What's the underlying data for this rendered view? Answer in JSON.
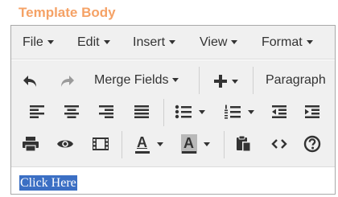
{
  "section": {
    "title": "Template Body"
  },
  "menubar": {
    "items": [
      {
        "label": "File"
      },
      {
        "label": "Edit"
      },
      {
        "label": "Insert"
      },
      {
        "label": "View"
      },
      {
        "label": "Format"
      }
    ]
  },
  "toolbar": {
    "row1": {
      "undo_icon": "undo-icon",
      "redo_icon": "redo-icon",
      "merge_fields_label": "Merge Fields",
      "insert_icon": "plus-icon",
      "block_format_label": "Paragraph"
    },
    "row2": {
      "icons": [
        "align-left-icon",
        "align-center-icon",
        "align-right-icon",
        "align-justify-icon",
        "bullet-list-icon",
        "numbered-list-icon",
        "outdent-icon",
        "indent-icon"
      ]
    },
    "row3": {
      "icons": [
        "print-icon",
        "preview-eye-icon",
        "media-icon",
        "text-color-icon",
        "background-color-icon",
        "paste-icon",
        "code-icon",
        "help-icon"
      ],
      "text_color_glyph": "A",
      "bg_color_glyph": "A"
    }
  },
  "colors": {
    "title": "#f5a266",
    "toolbar_bg": "#f0f0f0",
    "selection": "#3b6fc4",
    "redo_disabled": "#9a9a9a"
  },
  "content": {
    "text": "Click Here"
  }
}
